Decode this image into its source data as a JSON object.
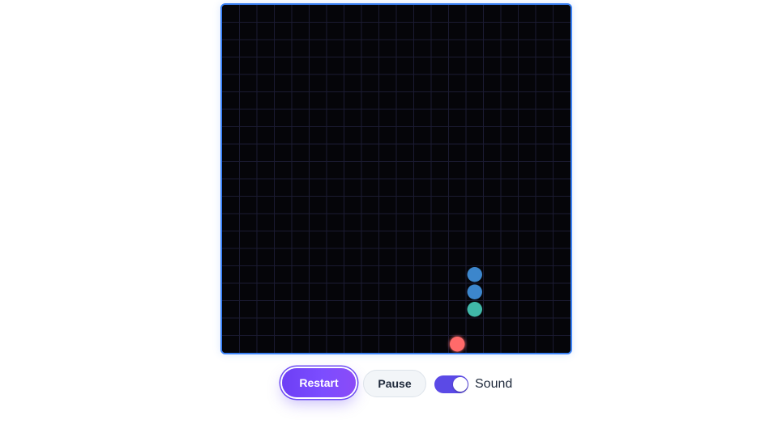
{
  "game": {
    "board": {
      "cols": 20,
      "rows": 20,
      "background_color": "#050509",
      "grid_color": "#1b1b32",
      "border_color": "#3b82f6"
    },
    "snake": [
      {
        "col": 14,
        "row": 17,
        "part": "head",
        "color": "#40b8a8"
      },
      {
        "col": 14,
        "row": 16,
        "part": "body",
        "color": "#3c86cc"
      },
      {
        "col": 14,
        "row": 15,
        "part": "body",
        "color": "#3c86cc"
      }
    ],
    "food": {
      "col": 13,
      "row": 19,
      "color": "#ff6b6b"
    }
  },
  "controls": {
    "restart_label": "Restart",
    "pause_label": "Pause",
    "sound_label": "Sound",
    "sound_enabled": true,
    "accent_color": "#6d4cf2"
  }
}
